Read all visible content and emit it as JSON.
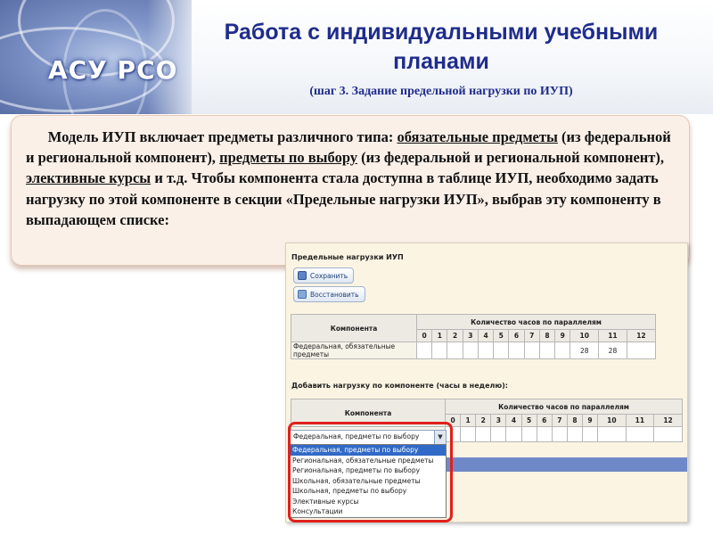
{
  "header": {
    "title": "Работа с индивидуальными учебными планами",
    "subtitle": "(шаг 3. Задание предельной нагрузки по ИУП)",
    "logo_text": "АСУ РСО"
  },
  "panel": {
    "t1": "Модель ИУП включает предметы различного типа: ",
    "u1": "обязательные предметы",
    "t2": " (из федеральной и региональной компонент), ",
    "u2": "предметы по выбору",
    "t3": " (из федеральной и региональной компонент), ",
    "u3": "элективные курсы",
    "t4": " и т.д. Чтобы компонента стала доступна в таблице ИУП, необходимо задать нагрузку по этой компоненте в секции «Предельные нагрузки ИУП», выбрав эту компоненту в выпадающем списке:"
  },
  "screen": {
    "section1": "Предельные нагрузки ИУП",
    "save_label": "Сохранить",
    "restore_label": "Восстановить",
    "col_component": "Компонента",
    "col_hours": "Количество часов по параллелям",
    "grades1": [
      "0",
      "1",
      "2",
      "3",
      "4",
      "5",
      "6",
      "7",
      "8",
      "9",
      "10",
      "11",
      "12"
    ],
    "row1": {
      "label": "Федеральная, обязательные предметы",
      "values": [
        "",
        "",
        "",
        "",
        "",
        "",
        "",
        "",
        "",
        "",
        "28",
        "28",
        ""
      ]
    },
    "section2": "Добавить нагрузку по компоненте (часы в неделю):",
    "grades2": [
      "0",
      "1",
      "2",
      "3",
      "4",
      "5",
      "6",
      "7",
      "8",
      "9",
      "10",
      "11",
      "12"
    ],
    "dropdown": {
      "selected": "Федеральная, предметы по выбору",
      "options": [
        "Федеральная, предметы по выбору",
        "Региональная, обязательные предметы",
        "Региональная, предметы по выбору",
        "Школьная, обязательные предметы",
        "Школьная, предметы по выбору",
        "Элективные курсы",
        "Консультации"
      ]
    }
  },
  "colors": {
    "title": "#1f2c8c",
    "panel_bg": "#fbf0e8",
    "highlight": "#e0201c",
    "selection": "#3169c6"
  }
}
